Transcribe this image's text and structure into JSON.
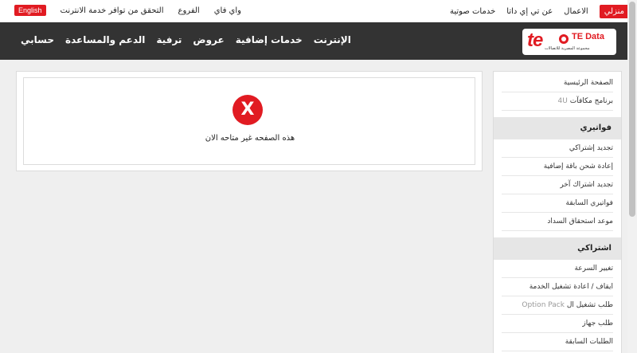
{
  "topbar": {
    "home": "منزلي",
    "business": "الاعمال",
    "about": "عن تي إي داتا",
    "voice": "خدمات صوتية",
    "wifi": "واي فاي",
    "branches": "الفروع",
    "coverage": "التحقق من توافر خدمة الانترنت",
    "language": "English"
  },
  "logo": {
    "mark": "te",
    "brand": "TE Data",
    "tagline": "مجموعة المصرية للاتصالات"
  },
  "nav": {
    "items": [
      "الإنترنت",
      "خدمات إضافية",
      "عروض",
      "ترفية",
      "الدعم والمساعدة",
      "حسابي"
    ]
  },
  "sidebar": {
    "top": [
      {
        "label": "الصفحة الرئيسية"
      },
      {
        "label": "برنامج مكافآت",
        "suffix": "4U"
      }
    ],
    "bills_title": "فواتيري",
    "bills": [
      {
        "label": "تجديد إشتراكي"
      },
      {
        "label": "إعادة شحن باقة إضافية"
      },
      {
        "label": "تجديد اشتراك آخر"
      },
      {
        "label": "فواتيري السابقة"
      },
      {
        "label": "موعد استحقاق السداد"
      }
    ],
    "subs_title": "اشتراكي",
    "subs": [
      {
        "label": "تغيير السرعة"
      },
      {
        "label": "ايقاف / اعادة تشغيل الخدمة"
      },
      {
        "label": "طلب تشغيل ال",
        "suffix": "Option Pack"
      },
      {
        "label": "طلب جهاز"
      },
      {
        "label": "الطلبات السابقة"
      }
    ]
  },
  "content": {
    "icon": "error-x-icon",
    "icon_glyph": "X",
    "message": "هذه الصفحه غير متاحه الان"
  },
  "colors": {
    "accent": "#e11b22",
    "nav_bg": "#333333",
    "page_bg": "#efefef"
  }
}
